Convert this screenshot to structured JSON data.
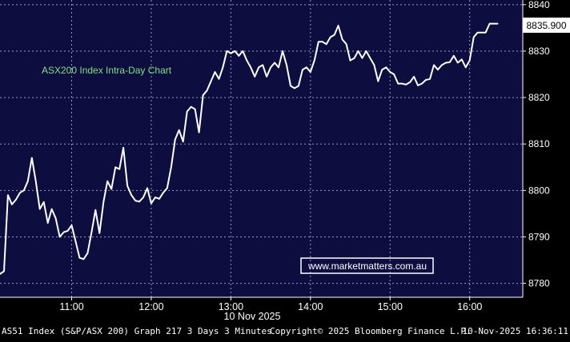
{
  "colors": {
    "background": "#000000",
    "plot_background": "#0d0d40",
    "gridline": "#9a9ab8",
    "line": "#ffffff",
    "annotation_text": "#7fe07f",
    "watermark_border": "#ffffff",
    "watermark_text": "#ffffff",
    "footer_text": "#ffffff"
  },
  "footer": {
    "left": "AS51 Index (S&P/ASX 200) Graph 217 3 Days 3 Minutes",
    "center": "Copyright© 2025 Bloomberg Finance L.P.",
    "right": "10-Nov-2025 16:36:11"
  },
  "chart_data": {
    "type": "line",
    "title": "",
    "annotation": "ASX200 Index Intra-Day Chart",
    "watermark": "www.marketmatters.com.au",
    "date_label": "10 Nov 2025",
    "last_value_label": "8835.900",
    "xlabel": "",
    "ylabel": "",
    "x_unit": "time_of_day",
    "xlim": [
      "10:06",
      "16:40"
    ],
    "ylim": [
      8777,
      8841
    ],
    "x_tick_labels": [
      "11:00",
      "12:00",
      "13:00",
      "14:00",
      "15:00",
      "16:00"
    ],
    "y_ticks": [
      8780,
      8790,
      8800,
      8810,
      8820,
      8830,
      8840
    ],
    "y_tick_labels": [
      "8780",
      "8790",
      "8800",
      "8810",
      "8820",
      "8830",
      "8840"
    ],
    "grid": true,
    "y_axis_position": "right",
    "series": [
      {
        "x": [
          "10:06",
          "10:09",
          "10:12",
          "10:15",
          "10:18",
          "10:21",
          "10:24",
          "10:27",
          "10:30",
          "10:33",
          "10:36",
          "10:39",
          "10:42",
          "10:45",
          "10:48",
          "10:51",
          "10:54",
          "10:57",
          "11:00",
          "11:03",
          "11:06",
          "11:09",
          "11:12",
          "11:15",
          "11:18",
          "11:21",
          "11:24",
          "11:27",
          "11:30",
          "11:33",
          "11:36",
          "11:39",
          "11:42",
          "11:45",
          "11:48",
          "11:51",
          "11:54",
          "11:57",
          "12:00",
          "12:03",
          "12:06",
          "12:09",
          "12:12",
          "12:15",
          "12:18",
          "12:21",
          "12:24",
          "12:27",
          "12:30",
          "12:33",
          "12:36",
          "12:39",
          "12:42",
          "12:45",
          "12:48",
          "12:51",
          "12:54",
          "12:57",
          "13:00",
          "13:03",
          "13:06",
          "13:09",
          "13:12",
          "13:15",
          "13:18",
          "13:21",
          "13:24",
          "13:27",
          "13:30",
          "13:33",
          "13:36",
          "13:39",
          "13:42",
          "13:45",
          "13:48",
          "13:51",
          "13:54",
          "13:57",
          "14:00",
          "14:03",
          "14:06",
          "14:09",
          "14:12",
          "14:15",
          "14:18",
          "14:21",
          "14:24",
          "14:27",
          "14:30",
          "14:33",
          "14:36",
          "14:39",
          "14:42",
          "14:45",
          "14:48",
          "14:51",
          "14:54",
          "14:57",
          "15:00",
          "15:03",
          "15:06",
          "15:09",
          "15:12",
          "15:15",
          "15:18",
          "15:21",
          "15:24",
          "15:27",
          "15:30",
          "15:33",
          "15:36",
          "15:39",
          "15:42",
          "15:45",
          "15:48",
          "15:51",
          "15:54",
          "15:57",
          "16:00",
          "16:03",
          "16:06",
          "16:09",
          "16:12",
          "16:15",
          "16:18",
          "16:21"
        ],
        "y": [
          8782.0,
          8782.6,
          8799.0,
          8797.0,
          8798.0,
          8799.5,
          8800.0,
          8802.0,
          8807.0,
          8802.0,
          8796.0,
          8797.5,
          8793.0,
          8796.0,
          8794.0,
          8790.0,
          8791.0,
          8791.3,
          8792.5,
          8789.0,
          8785.5,
          8785.2,
          8786.5,
          8791.0,
          8795.8,
          8790.8,
          8797.5,
          8802.0,
          8800.3,
          8805.0,
          8804.6,
          8809.2,
          8801.0,
          8799.0,
          8797.8,
          8797.6,
          8798.5,
          8800.5,
          8797.2,
          8798.5,
          8798.2,
          8799.5,
          8800.5,
          8805.0,
          8811.0,
          8813.0,
          8810.5,
          8817.0,
          8818.0,
          8817.5,
          8812.5,
          8820.5,
          8821.5,
          8823.5,
          8825.5,
          8824.0,
          8826.5,
          8830.0,
          8829.5,
          8830.0,
          8829.0,
          8830.0,
          8828.0,
          8826.5,
          8824.5,
          8826.5,
          8827.0,
          8824.5,
          8826.5,
          8827.5,
          8826.5,
          8830.0,
          8827.0,
          8822.5,
          8822.0,
          8822.5,
          8826.0,
          8826.5,
          8825.5,
          8828.0,
          8832.0,
          8832.0,
          8831.5,
          8833.0,
          8833.5,
          8835.5,
          8832.5,
          8831.5,
          8828.0,
          8828.5,
          8830.0,
          8828.5,
          8830.0,
          8828.5,
          8827.0,
          8823.5,
          8826.0,
          8826.5,
          8825.5,
          8825.0,
          8823.0,
          8823.0,
          8822.8,
          8823.3,
          8824.5,
          8822.6,
          8823.0,
          8823.8,
          8824.0,
          8827.0,
          8826.0,
          8827.0,
          8827.5,
          8827.6,
          8829.0,
          8827.5,
          8828.2,
          8826.5,
          8828.0,
          8833.0,
          8834.0,
          8834.0,
          8834.0,
          8835.9,
          8835.9,
          8835.9
        ]
      }
    ]
  }
}
